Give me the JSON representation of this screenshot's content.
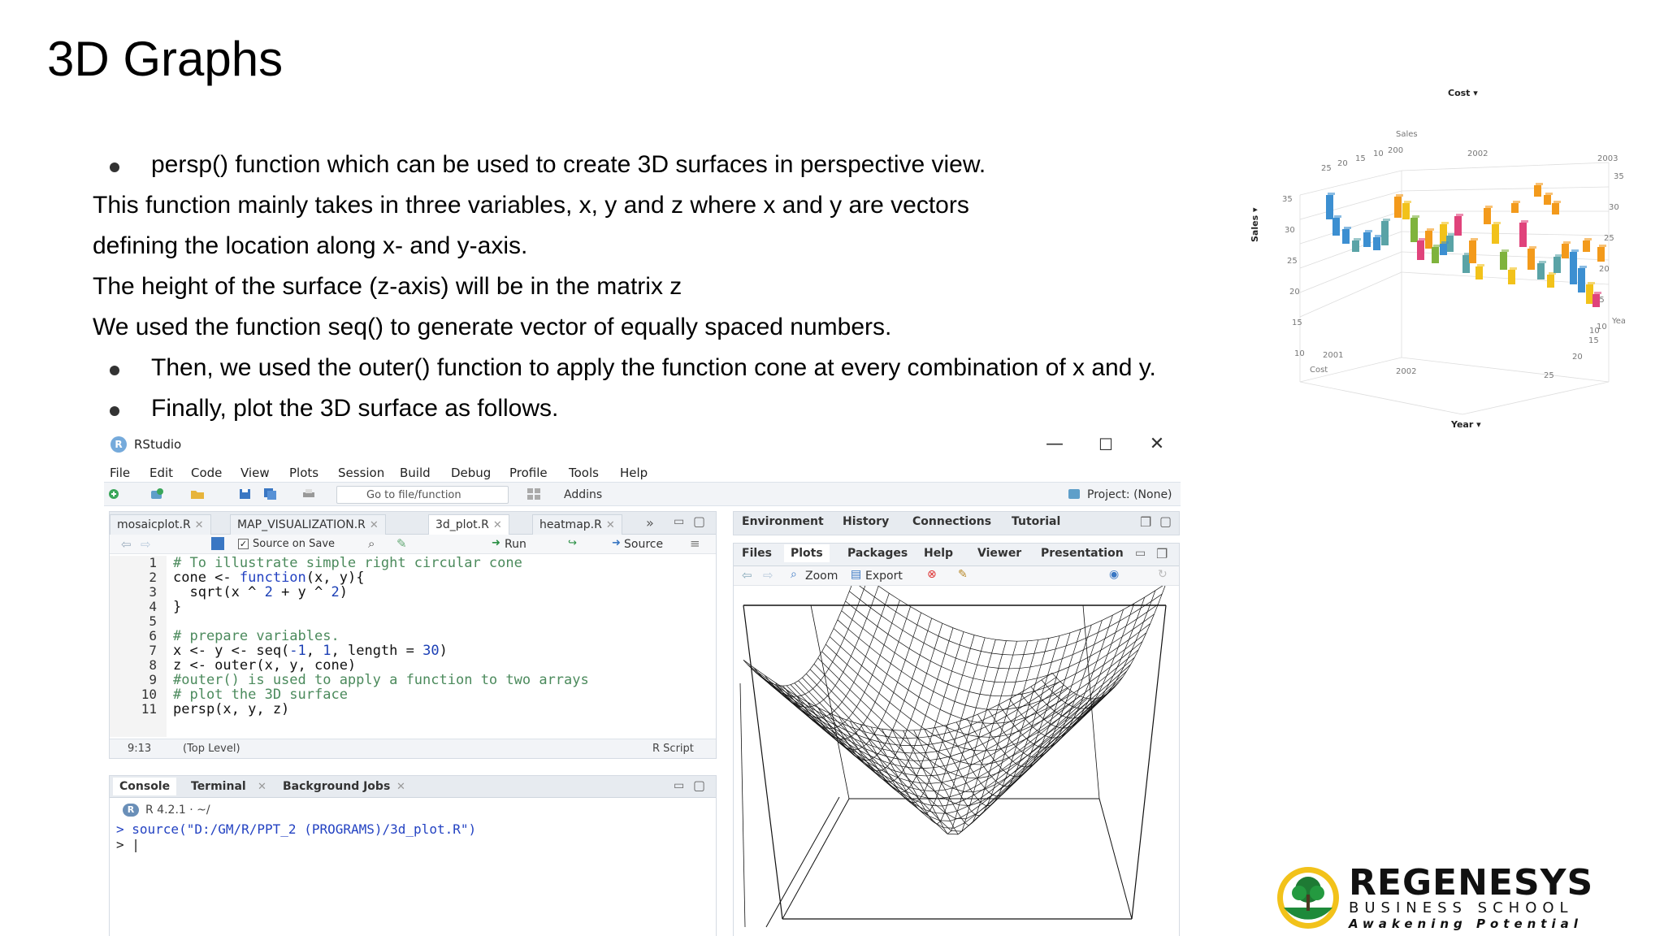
{
  "slide": {
    "title": "3D Graphs",
    "bullet1": "persp() function which can be used to create 3D surfaces in perspective view.",
    "line2": "This function mainly takes in three variables, x, y and z where x and y are vectors",
    "line3": "defining the location along x- and y-axis.",
    "line4": "The height of the surface (z-axis) will be in the matrix z",
    "line5": "We used the function seq() to generate vector of equally spaced numbers.",
    "bullet2": "Then, we used the outer() function to apply the function cone at every combination of x and y.",
    "bullet3": "Finally, plot the 3D surface as follows."
  },
  "rstudio": {
    "title": "RStudio",
    "logo_letter": "R",
    "window_controls": {
      "minimize": "—",
      "maximize": "☐",
      "close": "✕"
    },
    "menu": [
      "File",
      "Edit",
      "Code",
      "View",
      "Plots",
      "Session",
      "Build",
      "Debug",
      "Profile",
      "Tools",
      "Help"
    ],
    "toolbar": {
      "goto_placeholder": "Go to file/function",
      "addins": "Addins",
      "project": "Project: (None)"
    },
    "editor_tabs": [
      {
        "label": "mosaicplot.R",
        "active": false
      },
      {
        "label": "MAP_VISUALIZATION.R",
        "active": false
      },
      {
        "label": "3d_plot.R",
        "active": true
      },
      {
        "label": "heatmap.R",
        "active": false
      }
    ],
    "editor_toolbar": {
      "source_on_save": "Source on Save",
      "run": "Run",
      "source": "Source"
    },
    "code_lines": [
      {
        "n": "1",
        "text": "# To illustrate simple right circular cone"
      },
      {
        "n": "2",
        "text": "cone <- function(x, y){"
      },
      {
        "n": "3",
        "text": "  sqrt(x ^ 2 + y ^ 2)"
      },
      {
        "n": "4",
        "text": "}"
      },
      {
        "n": "5",
        "text": ""
      },
      {
        "n": "6",
        "text": "# prepare variables."
      },
      {
        "n": "7",
        "text": "x <- y <- seq(-1, 1, length = 30)"
      },
      {
        "n": "8",
        "text": "z <- outer(x, y, cone)"
      },
      {
        "n": "9",
        "text": "#outer() is used to apply a function to two arrays"
      },
      {
        "n": "10",
        "text": "# plot the 3D surface"
      },
      {
        "n": "11",
        "text": "persp(x, y, z)"
      }
    ],
    "editor_status": {
      "position": "9:13",
      "scope": "(Top Level)",
      "filetype": "R Script"
    },
    "console_tabs": [
      "Console",
      "Terminal",
      "Background Jobs"
    ],
    "console": {
      "version": "R 4.2.1 · ~/",
      "command": "> source(\"D:/GM/R/PPT_2 (PROGRAMS)/3d_plot.R\")",
      "prompt": "> |"
    },
    "env_tabs": [
      "Environment",
      "History",
      "Connections",
      "Tutorial"
    ],
    "files_tabs": [
      "Files",
      "Plots",
      "Packages",
      "Help",
      "Viewer",
      "Presentation"
    ],
    "plots_toolbar": {
      "zoom": "Zoom",
      "export": "Export"
    }
  },
  "chart3d": {
    "axis_selectors": {
      "top": "Cost",
      "left": "Sales",
      "bottom": "Year"
    },
    "labels": {
      "sales": "Sales",
      "cost": "Cost",
      "year": "Year"
    },
    "ticks_left": [
      "35",
      "30",
      "25",
      "20",
      "15",
      "10"
    ],
    "ticks_right": [
      "35",
      "30",
      "25",
      "20",
      "15",
      "10"
    ],
    "ticks_top": [
      "25",
      "20",
      "15",
      "10",
      "200",
      "2002",
      "2003"
    ],
    "ticks_front": [
      "2001",
      "2002",
      "25",
      "20",
      "15",
      "10"
    ],
    "colors": {
      "blue": "#3c8fd1",
      "yellow": "#f2c21a",
      "orange": "#f39a1b",
      "green": "#7fb33d",
      "pink": "#e0437b",
      "teal": "#5aa3a6"
    }
  },
  "logo": {
    "name": "REGENESYS",
    "sub": "BUSINESS SCHOOL",
    "tagline": "Awakening Potential"
  }
}
